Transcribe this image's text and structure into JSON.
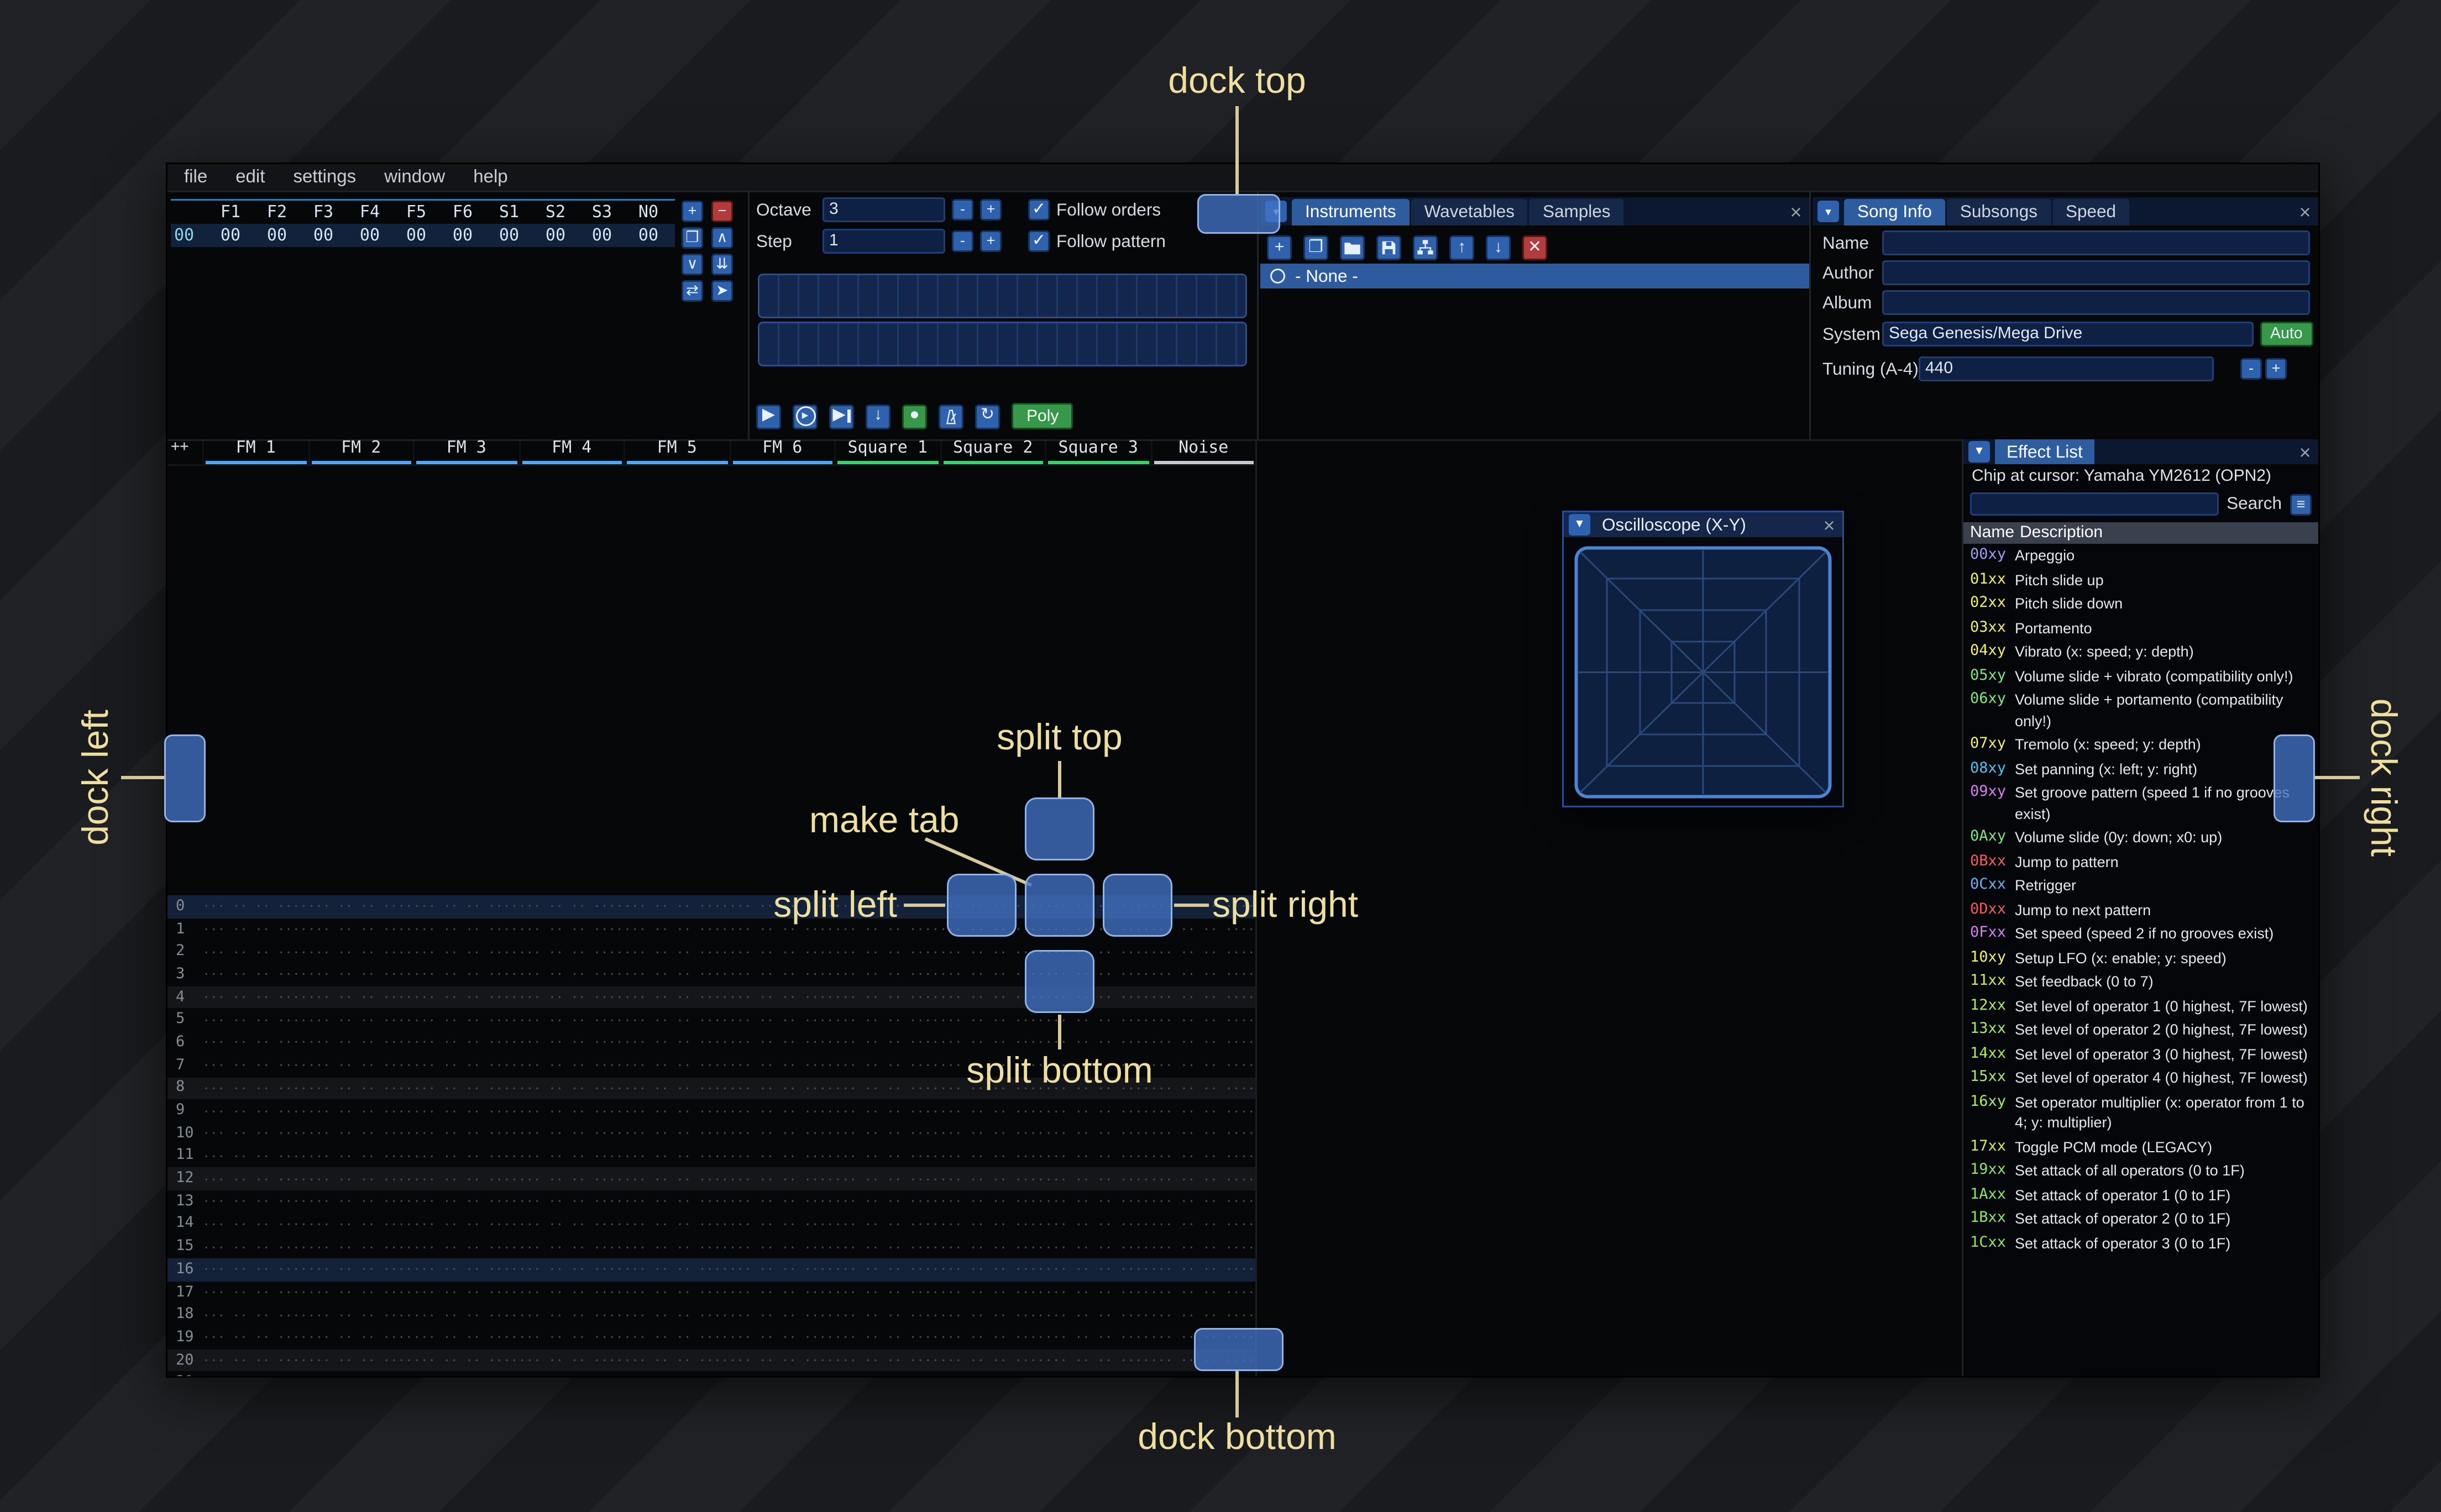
{
  "overlay": {
    "dock_top": "dock top",
    "dock_bottom": "dock bottom",
    "dock_left": "dock left",
    "dock_right": "dock right",
    "split_top": "split top",
    "split_bottom": "split bottom",
    "split_left": "split left",
    "split_right": "split right",
    "make_tab": "make tab"
  },
  "menu": {
    "items": [
      "file",
      "edit",
      "settings",
      "window",
      "help"
    ]
  },
  "orders": {
    "columns": [
      "F1",
      "F2",
      "F3",
      "F4",
      "F5",
      "F6",
      "S1",
      "S2",
      "S3",
      "N0"
    ],
    "rows": [
      {
        "index": "00",
        "values": [
          "00",
          "00",
          "00",
          "00",
          "00",
          "00",
          "00",
          "00",
          "00",
          "00"
        ]
      }
    ],
    "buttons": [
      {
        "name": "add",
        "glyph": "+",
        "style": "blue"
      },
      {
        "name": "remove",
        "glyph": "−",
        "style": "red"
      },
      {
        "name": "duplicate",
        "glyph": "❐",
        "style": "blue"
      },
      {
        "name": "move-up",
        "glyph": "∧",
        "style": "blue"
      },
      {
        "name": "move-down",
        "glyph": "∨",
        "style": "blue"
      },
      {
        "name": "duplicate-to-end",
        "glyph": "⇊",
        "style": "blue"
      },
      {
        "name": "playback-mode",
        "glyph": "⇄",
        "style": "blue"
      },
      {
        "name": "edit-mode",
        "glyph": "➤",
        "style": "blue"
      }
    ]
  },
  "controls": {
    "octave_label": "Octave",
    "octave_value": "3",
    "step_label": "Step",
    "step_value": "1",
    "minus": "-",
    "plus": "+",
    "follow_orders": "Follow orders",
    "follow_pattern": "Follow pattern",
    "play_buttons": [
      {
        "icon": "play",
        "name": "play"
      },
      {
        "icon": "playring",
        "name": "play-from-cursor"
      },
      {
        "icon": "stepone",
        "name": "step-one-row"
      },
      {
        "icon": "down",
        "name": "cursor-down"
      },
      {
        "icon": "record",
        "name": "record",
        "style": "green"
      },
      {
        "icon": "metronome",
        "name": "metronome"
      },
      {
        "icon": "repeat",
        "name": "repeat-pattern"
      }
    ],
    "poly": "Poly"
  },
  "assets": {
    "tabs": [
      {
        "label": "Instruments",
        "active": true
      },
      {
        "label": "Wavetables",
        "active": false
      },
      {
        "label": "Samples",
        "active": false
      }
    ],
    "toolbar": [
      {
        "icon": "plus",
        "name": "add"
      },
      {
        "icon": "clone",
        "name": "clone"
      },
      {
        "icon": "open",
        "name": "open"
      },
      {
        "icon": "save",
        "name": "save"
      },
      {
        "icon": "sitemap",
        "name": "organize"
      },
      {
        "icon": "up",
        "name": "move-up"
      },
      {
        "icon": "down",
        "name": "move-down"
      },
      {
        "icon": "del",
        "name": "delete",
        "style": "red"
      }
    ],
    "selected_item": "- None -"
  },
  "song_info": {
    "tabs": [
      {
        "label": "Song Info",
        "active": true
      },
      {
        "label": "Subsongs",
        "active": false
      },
      {
        "label": "Speed",
        "active": false
      }
    ],
    "name_label": "Name",
    "name_value": "",
    "author_label": "Author",
    "author_value": "",
    "album_label": "Album",
    "album_value": "",
    "system_label": "System",
    "system_value": "Sega Genesis/Mega Drive",
    "auto_label": "Auto",
    "tuning_label": "Tuning (A-4)",
    "tuning_value": "440",
    "minus": "-",
    "plus": "+"
  },
  "pattern": {
    "corner": "++",
    "channels": [
      {
        "name": "FM 1",
        "color": "#4fa7f7"
      },
      {
        "name": "FM 2",
        "color": "#4fa7f7"
      },
      {
        "name": "FM 3",
        "color": "#4fa7f7"
      },
      {
        "name": "FM 4",
        "color": "#4fa7f7"
      },
      {
        "name": "FM 5",
        "color": "#4fa7f7"
      },
      {
        "name": "FM 6",
        "color": "#4fa7f7"
      },
      {
        "name": "Square 1",
        "color": "#3fd06e"
      },
      {
        "name": "Square 2",
        "color": "#3fd06e"
      },
      {
        "name": "Square 3",
        "color": "#3fd06e"
      },
      {
        "name": "Noise",
        "color": "#c4cad2"
      }
    ],
    "row_count": 22,
    "empty_cell": "··· ·· ·· ····",
    "highlight_major": 16,
    "highlight_minor": 4
  },
  "oscilloscope": {
    "title": "Oscilloscope (X-Y)"
  },
  "effect_list": {
    "title": "Effect List",
    "chip_line": "Chip at cursor: Yamaha YM2612 (OPN2)",
    "search_label": "Search",
    "search_value": "",
    "col_name": "Name",
    "col_desc": "Description",
    "effects": [
      {
        "code": "00xy",
        "desc": "Arpeggio",
        "color": "#9d9df2"
      },
      {
        "code": "01xx",
        "desc": "Pitch slide up",
        "color": "#f2ef6d"
      },
      {
        "code": "02xx",
        "desc": "Pitch slide down",
        "color": "#f2ef6d"
      },
      {
        "code": "03xx",
        "desc": "Portamento",
        "color": "#f2ef6d"
      },
      {
        "code": "04xy",
        "desc": "Vibrato (x: speed; y: depth)",
        "color": "#f2ef6d"
      },
      {
        "code": "05xy",
        "desc": "Volume slide + vibrato (compatibility only!)",
        "color": "#7de87d"
      },
      {
        "code": "06xy",
        "desc": "Volume slide + portamento (compatibility only!)",
        "color": "#7de87d"
      },
      {
        "code": "07xy",
        "desc": "Tremolo (x: speed; y: depth)",
        "color": "#f2ef6d"
      },
      {
        "code": "08xy",
        "desc": "Set panning (x: left; y: right)",
        "color": "#4cc4f2"
      },
      {
        "code": "09xy",
        "desc": "Set groove pattern (speed 1 if no grooves exist)",
        "color": "#d97df2"
      },
      {
        "code": "0Axy",
        "desc": "Volume slide (0y: down; x0: up)",
        "color": "#7de87d"
      },
      {
        "code": "0Bxx",
        "desc": "Jump to pattern",
        "color": "#f25d5d"
      },
      {
        "code": "0Cxx",
        "desc": "Retrigger",
        "color": "#6cb1f2"
      },
      {
        "code": "0Dxx",
        "desc": "Jump to next pattern",
        "color": "#f25d5d"
      },
      {
        "code": "0Fxx",
        "desc": "Set speed (speed 2 if no grooves exist)",
        "color": "#d97df2"
      },
      {
        "code": "10xy",
        "desc": "Setup LFO (x: enable; y: speed)",
        "color": "#f2ef6d"
      },
      {
        "code": "11xx",
        "desc": "Set feedback (0 to 7)",
        "color": "#cdec62"
      },
      {
        "code": "12xx",
        "desc": "Set level of operator 1 (0 highest, 7F lowest)",
        "color": "#a8ec62"
      },
      {
        "code": "13xx",
        "desc": "Set level of operator 2 (0 highest, 7F lowest)",
        "color": "#a8ec62"
      },
      {
        "code": "14xx",
        "desc": "Set level of operator 3 (0 highest, 7F lowest)",
        "color": "#a8ec62"
      },
      {
        "code": "15xx",
        "desc": "Set level of operator 4 (0 highest, 7F lowest)",
        "color": "#a8ec62"
      },
      {
        "code": "16xy",
        "desc": "Set operator multiplier (x: operator from 1 to 4; y: multiplier)",
        "color": "#a8ec62"
      },
      {
        "code": "17xx",
        "desc": "Toggle PCM mode (LEGACY)",
        "color": "#cdec62"
      },
      {
        "code": "19xx",
        "desc": "Set attack of all operators (0 to 1F)",
        "color": "#8ce862"
      },
      {
        "code": "1Axx",
        "desc": "Set attack of operator 1 (0 to 1F)",
        "color": "#8ce862"
      },
      {
        "code": "1Bxx",
        "desc": "Set attack of operator 2 (0 to 1F)",
        "color": "#8ce862"
      },
      {
        "code": "1Cxx",
        "desc": "Set attack of operator 3 (0 to 1F)",
        "color": "#8ce862"
      }
    ]
  },
  "icons": {
    "dropdown": "▾",
    "collapse": "▼",
    "close": "×",
    "check": "✓",
    "hamburger": "≡",
    "plus": "+",
    "minus": "−",
    "up": "↑",
    "down": "↓",
    "del": "✕",
    "play": "▶",
    "record": "●",
    "repeat": "↻",
    "clone": "❐"
  }
}
